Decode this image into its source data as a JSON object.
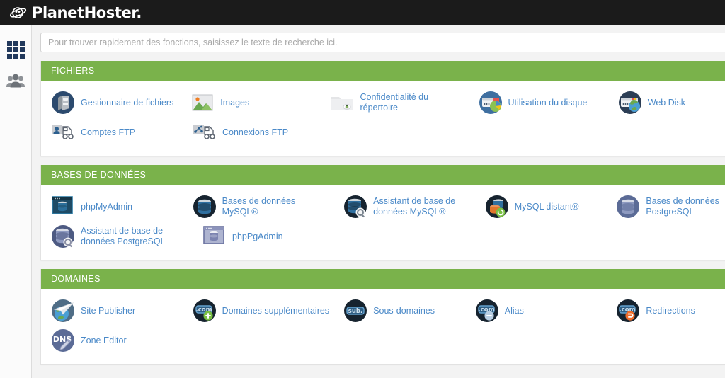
{
  "header": {
    "brand_name": "PlanetHoster.",
    "brand_icon": "planet-swoosh-logo"
  },
  "sidebar": {
    "items": [
      {
        "name": "apps-grid",
        "icon": "grid-icon",
        "label": ""
      },
      {
        "name": "users",
        "icon": "users-icon",
        "label": ""
      }
    ]
  },
  "search": {
    "placeholder": "Pour trouver rapidement des fonctions, saisissez le texte de recherche ici.",
    "value": ""
  },
  "sections": [
    {
      "title": "FICHIERS",
      "items": [
        {
          "label": "Gestionnaire de fichiers",
          "icon": "file-cabinet-icon"
        },
        {
          "label": "Images",
          "icon": "picture-icon"
        },
        {
          "label": "Confidentialité du répertoire",
          "icon": "folder-eye-icon"
        },
        {
          "label": "Utilisation du disque",
          "icon": "disk-usage-pie-icon"
        },
        {
          "label": "Web Disk",
          "icon": "web-disk-globe-icon"
        },
        {
          "label": "Comptes FTP",
          "icon": "ftp-truck-user-icon"
        },
        {
          "label": "Connexions FTP",
          "icon": "ftp-truck-network-icon"
        }
      ]
    },
    {
      "title": "BASES DE DONNÉES",
      "items": [
        {
          "label": "phpMyAdmin",
          "icon": "phpmyadmin-window-icon"
        },
        {
          "label": "Bases de données MySQL®",
          "icon": "mysql-database-icon"
        },
        {
          "label": "Assistant de base de données MySQL®",
          "icon": "mysql-wizard-icon"
        },
        {
          "label": "MySQL distant®",
          "icon": "mysql-remote-icon"
        },
        {
          "label": "Bases de données PostgreSQL",
          "icon": "postgres-database-icon"
        },
        {
          "label": "Assistant de base de données PostgreSQL",
          "icon": "postgres-wizard-icon"
        },
        {
          "label": "phpPgAdmin",
          "icon": "phppgadmin-window-icon"
        }
      ]
    },
    {
      "title": "DOMAINES",
      "items": [
        {
          "label": "Site Publisher",
          "icon": "site-publisher-plane-icon"
        },
        {
          "label": "Domaines supplémentaires",
          "icon": "addon-domain-plus-icon"
        },
        {
          "label": "Sous-domaines",
          "icon": "subdomain-icon"
        },
        {
          "label": "Alias",
          "icon": "alias-minus-icon"
        },
        {
          "label": "Redirections",
          "icon": "redirect-arrow-icon"
        },
        {
          "label": "Zone Editor",
          "icon": "dns-zone-editor-icon"
        }
      ]
    }
  ],
  "colors": {
    "topbar": "#1b1b1b",
    "section_header_green": "#7ab24b",
    "link_blue": "#4a89c8",
    "page_background": "#f3f3f3",
    "rail_background": "#fbfbfb"
  },
  "badge_labels": {
    "dotcom": ".com",
    "sub": "sub.",
    "dns": "DNS"
  }
}
